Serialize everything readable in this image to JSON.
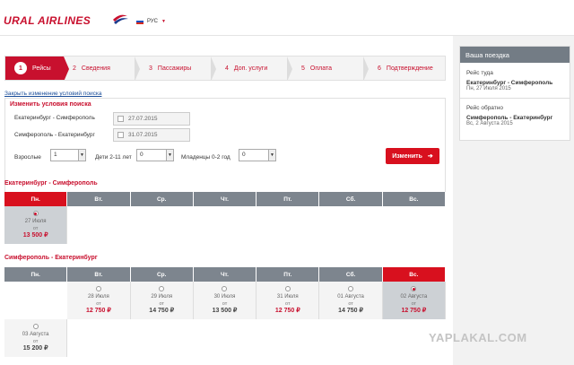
{
  "brand": {
    "name": "URAL AIRLINES"
  },
  "header": {
    "language": "РУС"
  },
  "steps": [
    {
      "num": "1",
      "label": "Рейсы",
      "active": true
    },
    {
      "num": "2",
      "label": "Сведения"
    },
    {
      "num": "3",
      "label": "Пассажиры"
    },
    {
      "num": "4",
      "label": "Доп. услуги"
    },
    {
      "num": "5",
      "label": "Оплата"
    },
    {
      "num": "6",
      "label": "Подтверждение"
    }
  ],
  "search": {
    "close_link": "Закрыть изменение условий поиска",
    "title": "Изменить условия поиска",
    "route1": {
      "label": "Екатеринбург - Симферополь",
      "date": "27.07.2015"
    },
    "route2": {
      "label": "Симферополь - Екатеринбург",
      "date": "31.07.2015"
    },
    "adults": {
      "label": "Взрослые",
      "value": "1"
    },
    "children": {
      "label": "Дети 2-11 лет",
      "value": "0"
    },
    "infants": {
      "label": "Младенцы 0-2 год",
      "value": "0"
    },
    "change_button": "Изменить"
  },
  "outbound": {
    "title": "Екатеринбург - Симферополь",
    "days": [
      "Пн.",
      "Вт.",
      "Ср.",
      "Чт.",
      "Пт.",
      "Сб.",
      "Вс."
    ],
    "flights": [
      {
        "date": "27 Июля",
        "from": "от",
        "price": "13 500 ₽"
      }
    ]
  },
  "return": {
    "title": "Симферополь - Екатеринбург",
    "days": [
      "Пн.",
      "Вт.",
      "Ср.",
      "Чт.",
      "Пт.",
      "Сб.",
      "Вс."
    ],
    "flights": [
      {
        "date": "28 Июля",
        "from": "от",
        "price": "12 750 ₽"
      },
      {
        "date": "29 Июля",
        "from": "от",
        "price": "14 750 ₽"
      },
      {
        "date": "30 Июля",
        "from": "от",
        "price": "13 500 ₽"
      },
      {
        "date": "31 Июля",
        "from": "от",
        "price": "12 750 ₽"
      },
      {
        "date": "01 Августа",
        "from": "от",
        "price": "14 750 ₽"
      },
      {
        "date": "02 Августа",
        "from": "от",
        "price": "12 750 ₽"
      },
      {
        "date": "03 Августа",
        "from": "от",
        "price": "15 200 ₽"
      }
    ]
  },
  "trip": {
    "title": "Ваша поездка",
    "outbound_label": "Рейс туда",
    "outbound_route": "Екатеринбург - Симферополь",
    "outbound_date": "Пн, 27 Июля 2015",
    "return_label": "Рейс обратно",
    "return_route": "Симферополь - Екатеринбург",
    "return_date": "Вс, 2 Августа 2015"
  },
  "watermark": "YAPLAKAL.COM",
  "colors": {
    "brand_red": "#c8102e",
    "header_gray": "#7d858e",
    "button_red": "#d8101e"
  }
}
